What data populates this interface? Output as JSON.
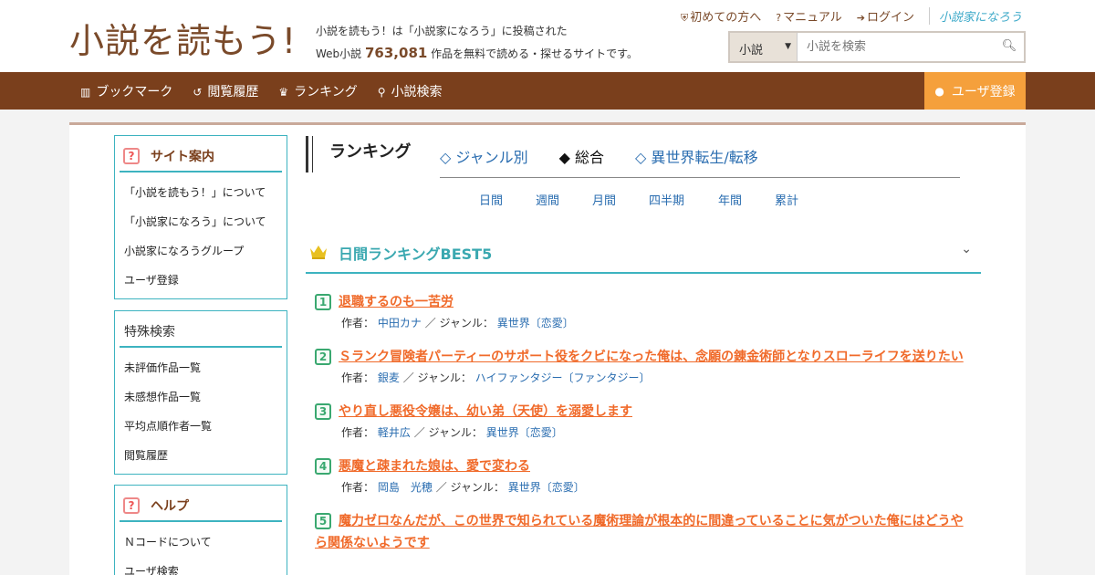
{
  "header": {
    "logo": "小説を読もう!",
    "tagline_line1": "小説を読もう！は「小説家になろう」に投稿された",
    "tagline_prefix": "Web小説",
    "novel_count": "763,081",
    "tagline_suffix": "作品を無料で読める・探せるサイトです。",
    "links": {
      "beginner": "初めての方へ",
      "manual": "マニュアル",
      "login": "ログイン",
      "brand": "小説家になろう"
    },
    "search": {
      "category": "小説",
      "placeholder": "小説を検索"
    }
  },
  "nav": {
    "items": [
      {
        "icon": "bookmark-icon",
        "label": "ブックマーク"
      },
      {
        "icon": "history-icon",
        "label": "閲覧履歴"
      },
      {
        "icon": "crown-icon",
        "label": "ランキング"
      },
      {
        "icon": "search-icon",
        "label": "小説検索"
      }
    ],
    "register": "ユーザ登録"
  },
  "sidebar": {
    "site_guide": {
      "title": "サイト案内",
      "items": [
        "「小説を読もう！」について",
        "「小説家になろう」について",
        "小説家になろうグループ",
        "ユーザ登録"
      ]
    },
    "special_search": {
      "title": "特殊検索",
      "items": [
        "未評価作品一覧",
        "未感想作品一覧",
        "平均点順作者一覧",
        "閲覧履歴"
      ]
    },
    "help": {
      "title": "ヘルプ",
      "items": [
        "Ｎコードについて",
        "ユーザ検索"
      ]
    }
  },
  "ranking": {
    "heading": "ランキング",
    "tabs": [
      "◇ ジャンル別",
      "◆ 総合",
      "◇ 異世界転生/転移"
    ],
    "periods": [
      "日間",
      "週間",
      "月間",
      "四半期",
      "年間",
      "累計"
    ],
    "best_title": "日間ランキングBEST5",
    "author_label": "作者：",
    "genre_label": "／ ジャンル：",
    "items": [
      {
        "rank": "1",
        "title": "退職するのも一苦労",
        "author": "中田カナ",
        "genre": "異世界〔恋愛〕"
      },
      {
        "rank": "2",
        "title": "Ｓランク冒険者パーティーのサポート役をクビになった俺は、念願の錬金術師となりスローライフを送りたい",
        "author": "銀麦",
        "genre": "ハイファンタジー〔ファンタジー〕"
      },
      {
        "rank": "3",
        "title": "やり直し悪役令嬢は、幼い弟（天使）を溺愛します",
        "author": "軽井広",
        "genre": "異世界〔恋愛〕"
      },
      {
        "rank": "4",
        "title": "悪魔と疎まれた娘は、愛で変わる",
        "author": "岡島　光穂",
        "genre": "異世界〔恋愛〕"
      },
      {
        "rank": "5",
        "title": "魔力ゼロなんだが、この世界で知られている魔術理論が根本的に間違っていることに気がついた俺にはどうやら関係ないようです",
        "author": "",
        "genre": ""
      }
    ]
  }
}
